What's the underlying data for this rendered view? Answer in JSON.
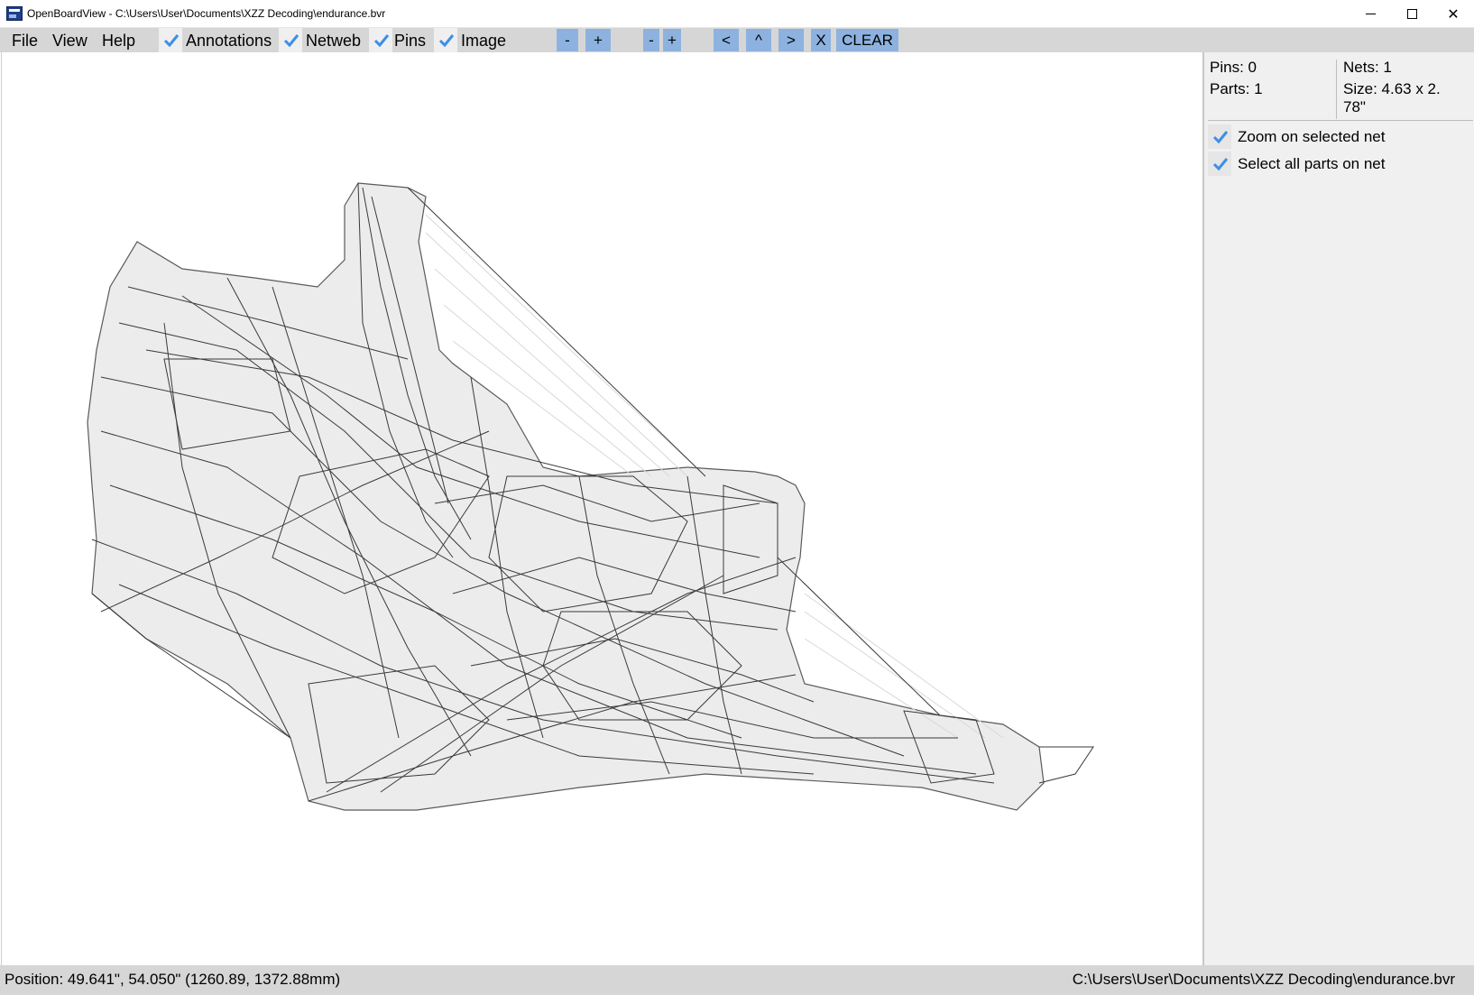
{
  "window": {
    "title": "OpenBoardView - C:\\Users\\User\\Documents\\XZZ Decoding\\endurance.bvr",
    "minimize": "",
    "maximize": "",
    "close": "✕"
  },
  "menu": {
    "file": "File",
    "view": "View",
    "help": "Help"
  },
  "toggles": [
    {
      "label": "Annotations",
      "checked": true
    },
    {
      "label": "Netweb",
      "checked": true
    },
    {
      "label": "Pins",
      "checked": true
    },
    {
      "label": "Image",
      "checked": true
    }
  ],
  "toolbar": {
    "zoom_out": "-",
    "zoom_in": "+",
    "zoom_out_2": "-",
    "zoom_in_2": "+",
    "left": "<",
    "up": "^",
    "right": ">",
    "x": "X",
    "clear": "CLEAR"
  },
  "panel": {
    "pins": "Pins: 0",
    "parts": "Parts: 1",
    "nets": "Nets: 1",
    "size": "Size: 4.63 x 2.",
    "size_cont": "78\"",
    "options": [
      {
        "label": "Zoom on selected net",
        "checked": true
      },
      {
        "label": "Select all parts on net",
        "checked": true
      }
    ]
  },
  "status": {
    "position": "Position: 49.641\", 54.050\" (1260.89, 1372.88mm)",
    "file_path": "C:\\Users\\User\\Documents\\XZZ Decoding\\endurance.bvr"
  },
  "colors": {
    "accent": "#8db2e0",
    "check": "#3d8ee8",
    "trace": "#3a3a3a",
    "fill": "#ececec"
  }
}
